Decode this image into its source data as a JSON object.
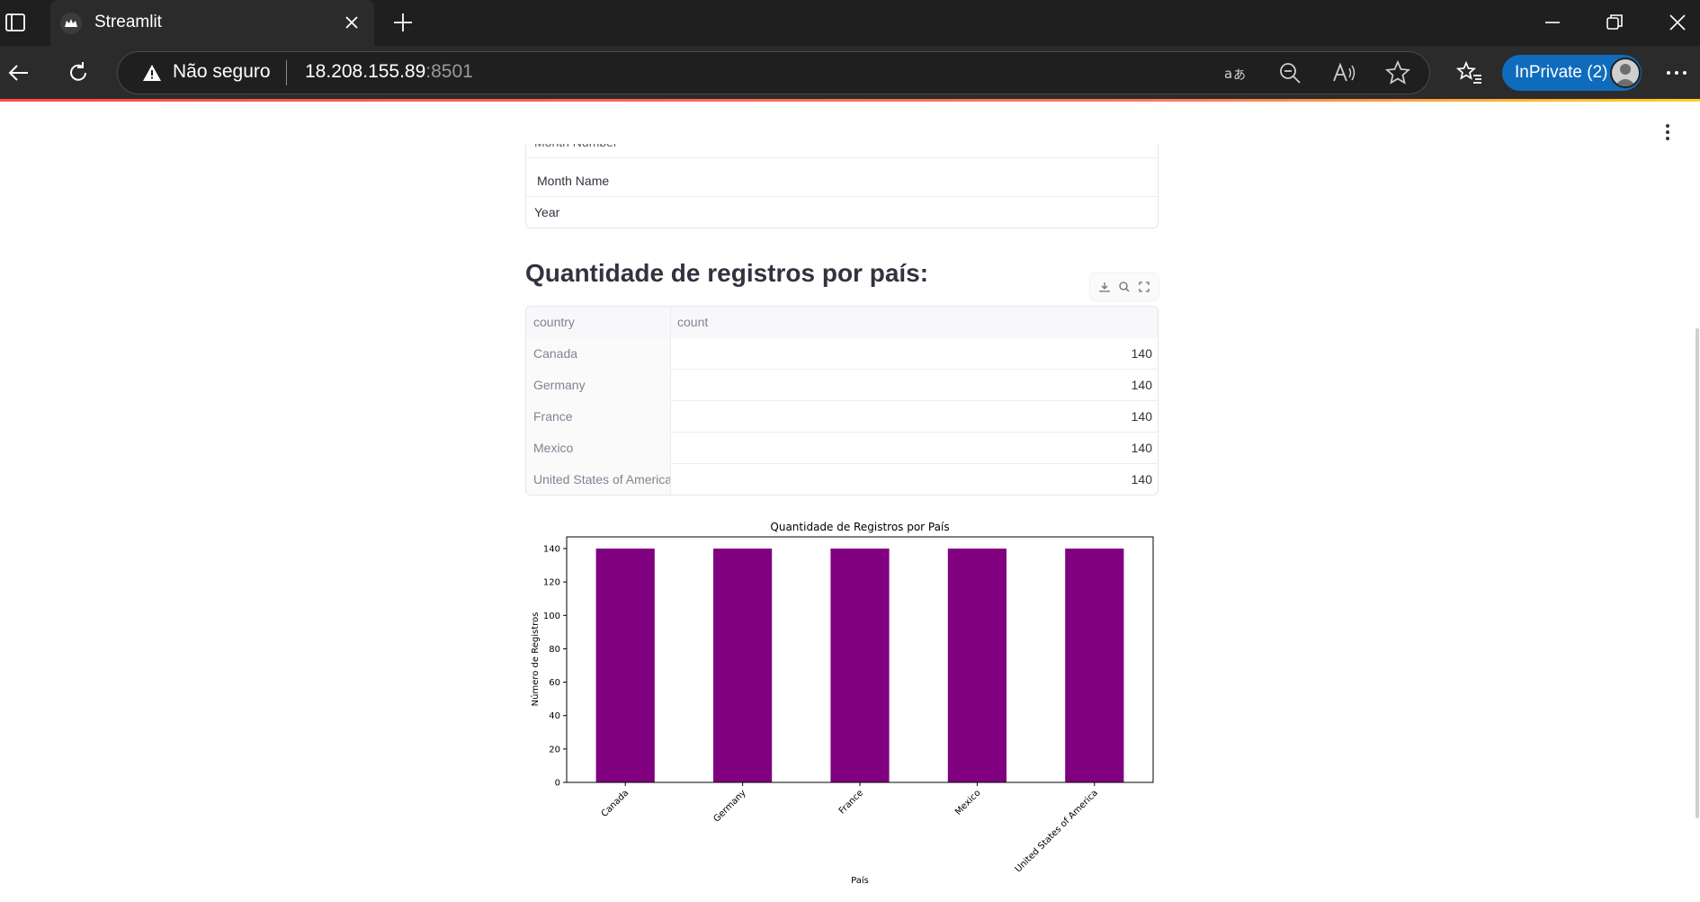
{
  "browser": {
    "tab_title": "Streamlit",
    "security_label": "Não seguro",
    "url_host": "18.208.155.89",
    "url_port": ":8501",
    "inprivate_label": "InPrivate (2)"
  },
  "page": {
    "select_items": [
      "Month Number",
      "Month Name",
      "Year"
    ],
    "section_title": "Quantidade de registros por país:",
    "table": {
      "columns": [
        "country",
        "count"
      ],
      "rows": [
        [
          "Canada",
          "140"
        ],
        [
          "Germany",
          "140"
        ],
        [
          "France",
          "140"
        ],
        [
          "Mexico",
          "140"
        ],
        [
          "United States of America",
          "140"
        ]
      ]
    }
  },
  "colors": {
    "bar": "#800080",
    "streamlit_accent": "#ff4b4b",
    "inprivate": "#0f6cbd"
  },
  "chart_data": {
    "type": "bar",
    "title": "Quantidade de Registros por País",
    "xlabel": "País",
    "ylabel": "Número de Registros",
    "categories": [
      "Canada",
      "Germany",
      "France",
      "Mexico",
      "United States of America"
    ],
    "values": [
      140,
      140,
      140,
      140,
      140
    ],
    "ylim": [
      0,
      147
    ],
    "yticks": [
      0,
      20,
      40,
      60,
      80,
      100,
      120,
      140
    ],
    "grid": false,
    "legend": "none"
  }
}
